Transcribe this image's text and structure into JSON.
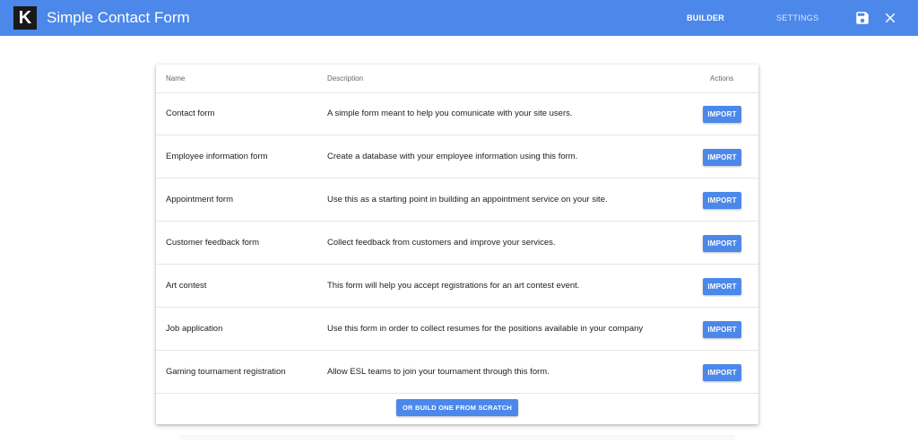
{
  "app": {
    "logo_letter": "K",
    "title": "Simple Contact Form"
  },
  "nav": {
    "builder": "BUILDER",
    "settings": "SETTINGS"
  },
  "icons": {
    "save": "save-icon",
    "close": "close-icon"
  },
  "colors": {
    "accent": "#4c88ea",
    "logo_bg": "#1a1a1a"
  },
  "table": {
    "headers": {
      "name": "Name",
      "description": "Description",
      "actions": "Actions"
    },
    "rows": [
      {
        "name": "Contact form",
        "description": "A simple form meant to help you comunicate with your site users.",
        "action": "IMPORT"
      },
      {
        "name": "Employee information form",
        "description": "Create a database with your employee information using this form.",
        "action": "IMPORT"
      },
      {
        "name": "Appointment form",
        "description": "Use this as a starting point in building an appointment service on your site.",
        "action": "IMPORT"
      },
      {
        "name": "Customer feedback form",
        "description": "Collect feedback from customers and improve your services.",
        "action": "IMPORT"
      },
      {
        "name": "Art contest",
        "description": "This form will help you accept registrations for an art contest event.",
        "action": "IMPORT"
      },
      {
        "name": "Job application",
        "description": "Use this form in order to collect resumes for the positions available in your company",
        "action": "IMPORT"
      },
      {
        "name": "Gaming tournament registration",
        "description": "Allow ESL teams to join your tournament through this form.",
        "action": "IMPORT"
      }
    ]
  },
  "footer": {
    "build_scratch": "OR BUILD ONE FROM SCRATCH"
  }
}
